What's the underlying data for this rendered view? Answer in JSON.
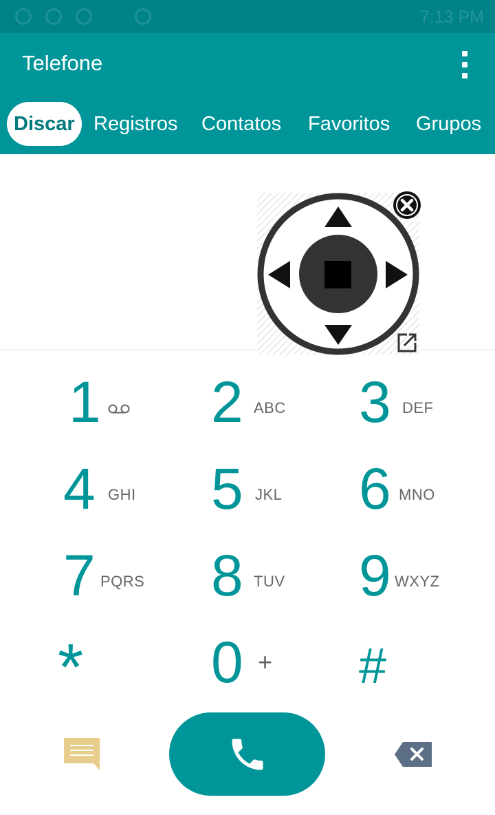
{
  "app": {
    "title": "Telefone",
    "accent_color": "#009699",
    "status_bar_color": "#008387"
  },
  "status_bar": {
    "time": "7:13 PM"
  },
  "tabs": [
    {
      "label": "Discar",
      "active": true
    },
    {
      "label": "Registros",
      "active": false
    },
    {
      "label": "Contatos",
      "active": false
    },
    {
      "label": "Favoritos",
      "active": false
    },
    {
      "label": "Grupos",
      "active": false
    }
  ],
  "floating_controller": {
    "icons": [
      "up-arrow-icon",
      "down-arrow-icon",
      "left-arrow-icon",
      "right-arrow-icon",
      "stop-icon",
      "close-icon",
      "open-external-icon"
    ]
  },
  "keypad": [
    {
      "digit": "1",
      "letters": "",
      "icon": "voicemail-icon"
    },
    {
      "digit": "2",
      "letters": "ABC"
    },
    {
      "digit": "3",
      "letters": "DEF"
    },
    {
      "digit": "4",
      "letters": "GHI"
    },
    {
      "digit": "5",
      "letters": "JKL"
    },
    {
      "digit": "6",
      "letters": "MNO"
    },
    {
      "digit": "7",
      "letters": "PQRS"
    },
    {
      "digit": "8",
      "letters": "TUV"
    },
    {
      "digit": "9",
      "letters": "WXYZ"
    },
    {
      "digit": "*",
      "letters": ""
    },
    {
      "digit": "0",
      "letters": "+"
    },
    {
      "digit": "#",
      "letters": ""
    }
  ],
  "actions": {
    "sms_icon": "message-icon",
    "call_icon": "phone-icon",
    "delete_icon": "backspace-icon",
    "sms_color": "#e8cd8c",
    "delete_color": "#5d6f86"
  }
}
